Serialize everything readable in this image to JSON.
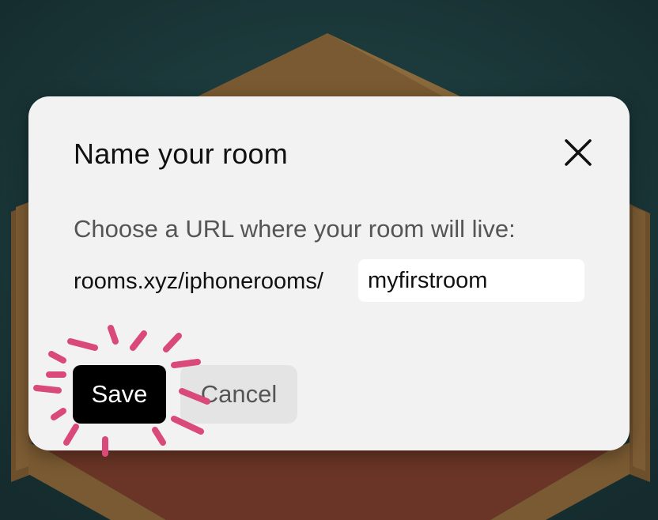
{
  "dialog": {
    "title": "Name your room",
    "prompt": "Choose a URL where your room will live:",
    "url_prefix": "rooms.xyz/iphonerooms/",
    "url_value": "myfirstroom",
    "save_label": "Save",
    "cancel_label": "Cancel",
    "close_icon": "close-icon"
  },
  "colors": {
    "background": "#1a3436",
    "dialog": "#f2f2f2",
    "save_button": "#000000",
    "cancel_button": "#e4e4e4",
    "highlight_marks": "#d9497a",
    "room_floor": "#6a3526",
    "room_wall": "#7a5a32"
  }
}
